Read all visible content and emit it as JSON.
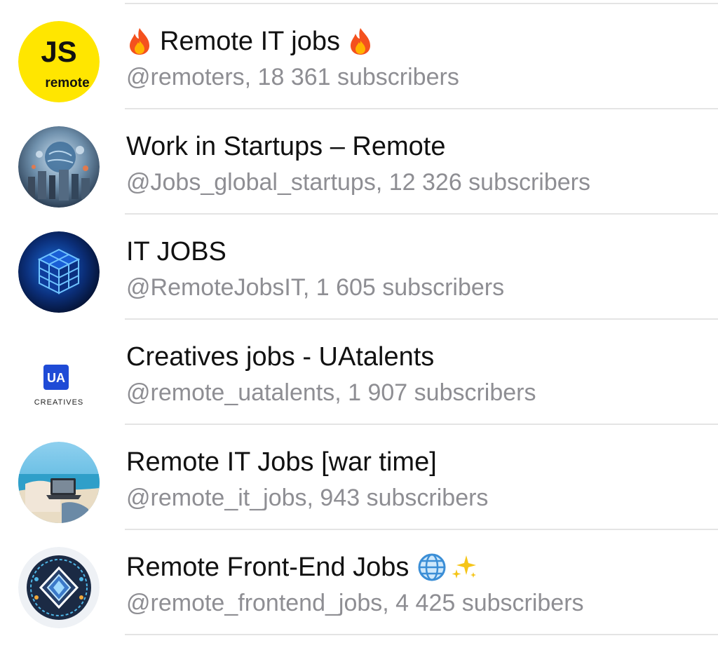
{
  "channels": [
    {
      "title": "Remote IT jobs",
      "title_prefix_icon": "fire-icon",
      "title_suffix_icon": "fire-icon",
      "subtitle": "@remoters, 18 361 subscribers",
      "avatar": {
        "type": "js-remote",
        "text_main": "JS",
        "text_sub": "remote",
        "bg": "#ffe600"
      }
    },
    {
      "title": "Work in Startups – Remote",
      "subtitle": "@Jobs_global_startups, 12 326 subscribers",
      "avatar": {
        "type": "globe-city"
      }
    },
    {
      "title": "IT JOBS",
      "subtitle": "@RemoteJobsIT, 1 605 subscribers",
      "avatar": {
        "type": "blue-cube"
      }
    },
    {
      "title": "Creatives jobs - UAtalents",
      "subtitle": "@remote_uatalents, 1 907 subscribers",
      "avatar": {
        "type": "ua-creatives",
        "logo_text": "UA",
        "caption": "CREATIVES",
        "accent": "#1f4bd6"
      }
    },
    {
      "title": "Remote IT Jobs [war time]",
      "subtitle": "@remote_it_jobs, 943 subscribers",
      "avatar": {
        "type": "beach-laptop"
      }
    },
    {
      "title": "Remote Front-End Jobs",
      "title_suffix_icons": [
        "globe-icon",
        "sparkles-icon"
      ],
      "subtitle": "@remote_frontend_jobs, 4 425 subscribers",
      "avatar": {
        "type": "frontend-diamond"
      }
    }
  ],
  "colors": {
    "title": "#111111",
    "subtitle": "#8e8e93",
    "divider": "#e4e4e4"
  }
}
